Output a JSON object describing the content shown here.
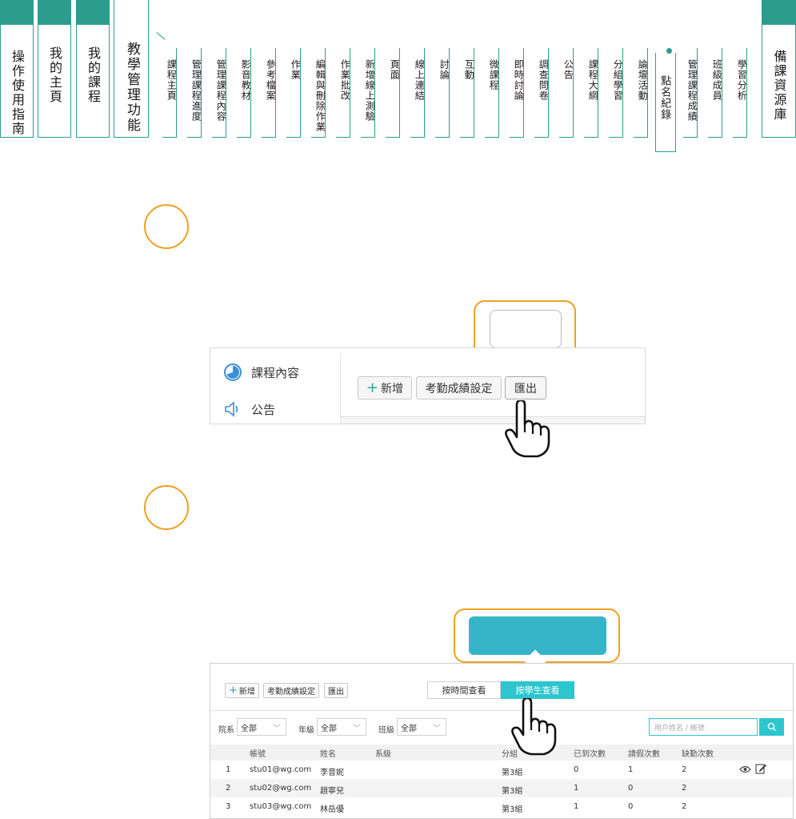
{
  "big_tabs": [
    {
      "label": "操作使用指南"
    },
    {
      "label": "我的主頁"
    },
    {
      "label": "我的課程"
    },
    {
      "label": "教學管理功能"
    }
  ],
  "small_tabs": [
    "課程主頁",
    "管理課程進度",
    "管理課程內容",
    "影音教材",
    "參考檔案",
    "作業",
    "編輯與刪除作業",
    "作業批改",
    "新增線上測驗",
    "頁面",
    "線上連結",
    "討論",
    "互動",
    "微課程",
    "即時討論",
    "調查問卷",
    "公告",
    "課程大綱",
    "分組學習",
    "論壇活動",
    "點名紀錄",
    "管理課程成績",
    "班級成員",
    "學習分析"
  ],
  "right_tab": {
    "label": "備課資源庫"
  },
  "active_tab": "點名紀錄",
  "shot1": {
    "sidebar": [
      {
        "label": "課程內容",
        "icon": "progress-pie-icon"
      },
      {
        "label": "公告",
        "icon": "speaker-icon"
      }
    ],
    "buttons": {
      "add": "新增",
      "attendance_settings": "考勤成績設定",
      "export": "匯出"
    }
  },
  "shot2": {
    "buttons": {
      "add": "新增",
      "attendance_settings": "考勤成績設定",
      "export": "匯出"
    },
    "view_toggle": {
      "by_time": "按時間查看",
      "by_student": "按學生查看"
    },
    "filters": [
      {
        "label": "院系",
        "value": "全部"
      },
      {
        "label": "年級",
        "value": "全部"
      },
      {
        "label": "班級",
        "value": "全部"
      }
    ],
    "search_placeholder": "用戶姓名 / 帳號",
    "columns": [
      "帳號",
      "姓名",
      "系級",
      "分組",
      "已到次數",
      "請假次數",
      "缺勤次數"
    ],
    "rows": [
      {
        "no": "1",
        "account": "stu01@wg.com",
        "name": "李音妮",
        "dept": "",
        "group": "第3組",
        "present": "0",
        "leave": "1",
        "absent": "2"
      },
      {
        "no": "2",
        "account": "stu02@wg.com",
        "name": "趙寧兒",
        "dept": "",
        "group": "第3組",
        "present": "1",
        "leave": "0",
        "absent": "2"
      },
      {
        "no": "3",
        "account": "stu03@wg.com",
        "name": "林岳優",
        "dept": "",
        "group": "第3組",
        "present": "1",
        "leave": "0",
        "absent": "2"
      }
    ]
  },
  "colors": {
    "teal": "#2a9d8f",
    "orange": "#f0a020",
    "cyan": "#2cc6cf",
    "bubble_fill": "#36b5c9"
  }
}
